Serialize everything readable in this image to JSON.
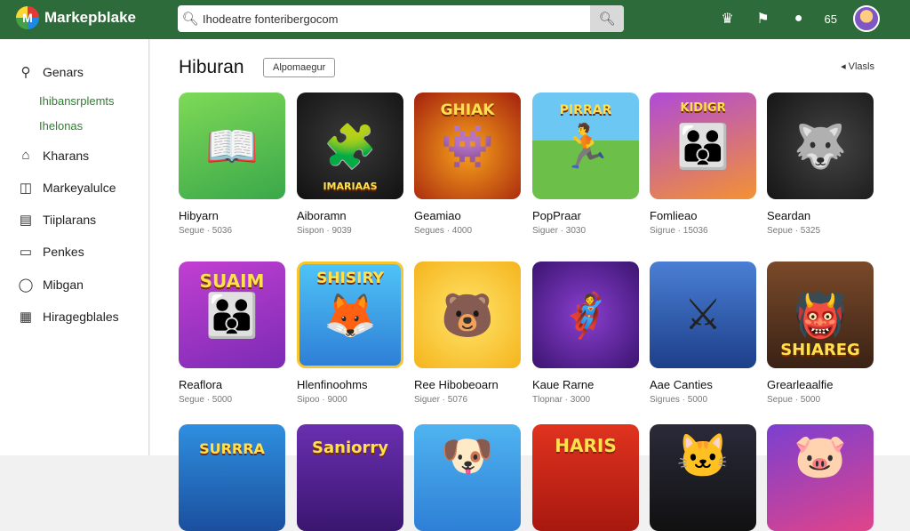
{
  "app": {
    "logo_letter": "M",
    "title": "Markepblake"
  },
  "search": {
    "query": "Ihodeatre fonteribergocom"
  },
  "header": {
    "count": "65"
  },
  "sidebar": {
    "items": [
      {
        "label": "Genars",
        "icon": "games-icon"
      },
      {
        "label": "Kharans",
        "icon": "home-icon"
      },
      {
        "label": "Markeyalulce",
        "icon": "marketplace-icon"
      },
      {
        "label": "Tiiplarans",
        "icon": "library-icon"
      },
      {
        "label": "Penkes",
        "icon": "packages-icon"
      },
      {
        "label": "Mibgan",
        "icon": "store-icon"
      },
      {
        "label": "Hiragegblales",
        "icon": "settings-icon"
      }
    ],
    "sub_items": [
      "Ihibansrplemts",
      "Ihelonas"
    ]
  },
  "main": {
    "title": "Hiburan",
    "chip": "Alpomaegur",
    "view_label": "Vlasls",
    "rows": [
      [
        {
          "name": "Hibyarn",
          "sub": "Segue · 5036",
          "art": ""
        },
        {
          "name": "Aiboramn",
          "sub": "Sispon · 9039",
          "art": "IMARIAAS"
        },
        {
          "name": "Geamiao",
          "sub": "Segues · 4000",
          "art": "GHIAK"
        },
        {
          "name": "PopPraar",
          "sub": "Siguer · 3030",
          "art": "PIRRAR"
        },
        {
          "name": "Fomlieao",
          "sub": "Sigrue · 15036",
          "art": "KIDIGR"
        },
        {
          "name": "Seardan",
          "sub": "Sepue · 5325",
          "art": ""
        }
      ],
      [
        {
          "name": "Reaflora",
          "sub": "Segue · 5000",
          "art": "SUAIM"
        },
        {
          "name": "Hlenfinoohms",
          "sub": "Sipoo · 9000",
          "art": "SHISIRY"
        },
        {
          "name": "Ree Hibobeoarn",
          "sub": "Siguer · 5076",
          "art": ""
        },
        {
          "name": "Kaue Rarne",
          "sub": "Tlopnar · 3000",
          "art": ""
        },
        {
          "name": "Aae Canties",
          "sub": "Sigrues · 5000",
          "art": ""
        },
        {
          "name": "Grearleaalfie",
          "sub": "Sepue · 5000",
          "art": "SHIAREG"
        }
      ],
      [
        {
          "name": "",
          "sub": "",
          "art": "SURRRA"
        },
        {
          "name": "",
          "sub": "",
          "art": "Saniorry"
        },
        {
          "name": "",
          "sub": "",
          "art": ""
        },
        {
          "name": "",
          "sub": "",
          "art": "HARIS"
        },
        {
          "name": "",
          "sub": "",
          "art": ""
        },
        {
          "name": "",
          "sub": "",
          "art": ""
        }
      ]
    ]
  },
  "colors": {
    "topbar": "#2e6b3a",
    "accent_green": "#2e7d32"
  }
}
